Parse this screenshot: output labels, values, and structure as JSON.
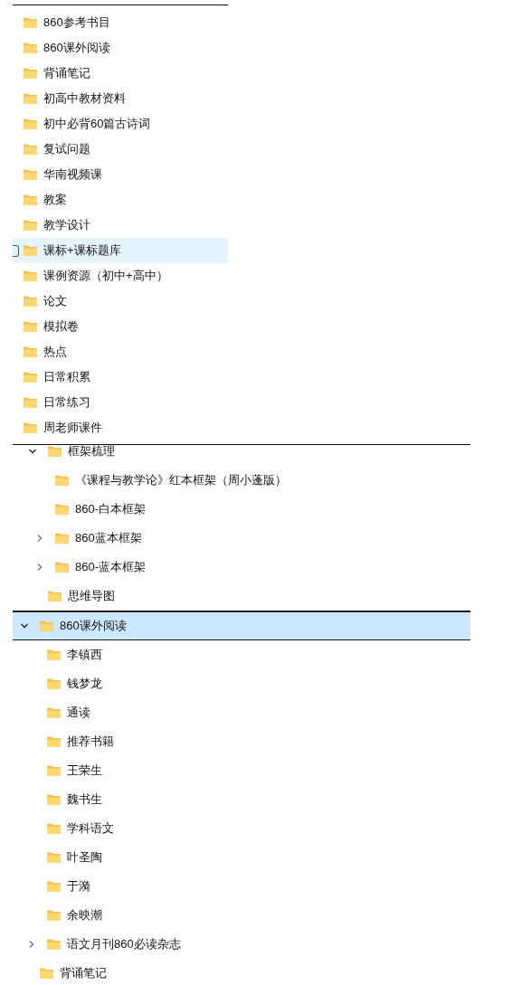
{
  "panels": [
    {
      "kind": "flat",
      "items": [
        {
          "label": "860参考书目",
          "hovered": false
        },
        {
          "label": "860课外阅读",
          "hovered": false
        },
        {
          "label": "背诵笔记",
          "hovered": false
        },
        {
          "label": "初高中教材资料",
          "hovered": false
        },
        {
          "label": "初中必背60篇古诗词",
          "hovered": false
        },
        {
          "label": "复试问题",
          "hovered": false
        },
        {
          "label": "华南视频课",
          "hovered": false
        },
        {
          "label": "教案",
          "hovered": false
        },
        {
          "label": "教学设计",
          "hovered": false
        },
        {
          "label": "课标+课标题库",
          "hovered": true
        },
        {
          "label": "课例资源（初中+高中）",
          "hovered": false
        },
        {
          "label": "论文",
          "hovered": false
        },
        {
          "label": "模拟卷",
          "hovered": false
        },
        {
          "label": "热点",
          "hovered": false
        },
        {
          "label": "日常积累",
          "hovered": false
        },
        {
          "label": "日常练习",
          "hovered": false
        },
        {
          "label": "周老师课件",
          "hovered": false
        }
      ]
    },
    {
      "kind": "tree",
      "items": [
        {
          "label": "框架梳理",
          "expanded": true,
          "selected": false,
          "children": [
            {
              "label": "《课程与教学论》红本框架（周小蓬版）",
              "selected": false
            },
            {
              "label": "860-白本框架",
              "selected": false
            },
            {
              "label": "860蓝本框架",
              "expanded": false,
              "selected": false
            },
            {
              "label": "860-蓝本框架",
              "expanded": false,
              "selected": false
            }
          ]
        },
        {
          "label": "思维导图",
          "selected": false
        }
      ]
    },
    {
      "kind": "tree",
      "items": [
        {
          "label": "860课外阅读",
          "expanded": true,
          "selected": true,
          "children": [
            {
              "label": "李镇西",
              "selected": false
            },
            {
              "label": "钱梦龙",
              "selected": false
            },
            {
              "label": "通读",
              "selected": false
            },
            {
              "label": "推荐书籍",
              "selected": false
            },
            {
              "label": "王荣生",
              "selected": false
            },
            {
              "label": "魏书生",
              "selected": false
            },
            {
              "label": "学科语文",
              "selected": false
            },
            {
              "label": "叶圣陶",
              "selected": false
            },
            {
              "label": "于漪",
              "selected": false
            },
            {
              "label": "余映潮",
              "selected": false
            },
            {
              "label": "语文月刊860必读杂志",
              "expanded": false,
              "selected": false
            }
          ]
        },
        {
          "label": "背诵笔记",
          "selected": false
        }
      ]
    }
  ]
}
